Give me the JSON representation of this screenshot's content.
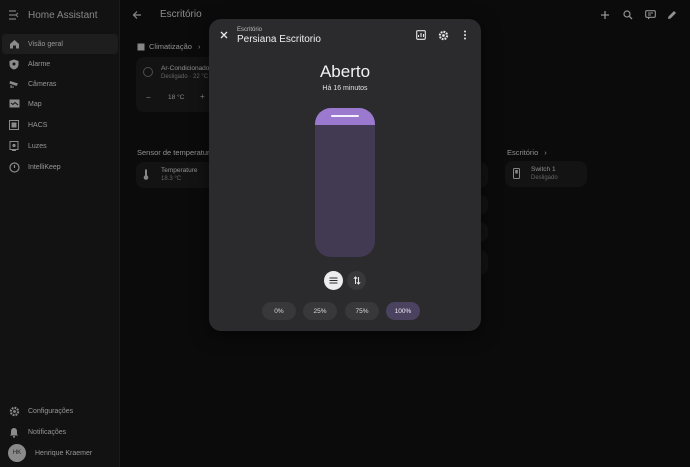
{
  "sidebar": {
    "title": "Home Assistant",
    "items": [
      {
        "label": "Visão geral",
        "icon": "home-icon"
      },
      {
        "label": "Alarme",
        "icon": "shield-icon"
      },
      {
        "label": "Câmeras",
        "icon": "cctv-icon"
      },
      {
        "label": "Map",
        "icon": "map-icon"
      },
      {
        "label": "HACS",
        "icon": "hacs-icon"
      },
      {
        "label": "Luzes",
        "icon": "lightbulb-icon"
      },
      {
        "label": "IntelliKeep",
        "icon": "intellikeep-icon"
      }
    ],
    "bottom": [
      {
        "label": "Configurações",
        "icon": "gear-icon"
      },
      {
        "label": "Notificações",
        "icon": "bell-icon"
      }
    ],
    "user": {
      "initials": "HK",
      "name": "Henrique Kraemer"
    }
  },
  "topbar": {
    "title": "Escritório"
  },
  "background": {
    "climate_section": "Climatização",
    "ac_name": "Ar-Condicionado",
    "ac_state": "Desligado · 22 °C",
    "ac_temp": "18 °C",
    "ac_minus": "−",
    "ac_plus": "+",
    "sensor_section": "Sensor de temperatura",
    "temp_name": "Temperature",
    "temp_value": "18.3 °C",
    "office_section": "Escritório",
    "switch_name": "Switch 1",
    "switch_state": "Desligado"
  },
  "dialog": {
    "subtitle": "Escritório",
    "title": "Persiana Escritorio",
    "state": "Aberto",
    "since": "Há 16 minutos",
    "position_percent": 100,
    "presets": [
      "0%",
      "25%",
      "75%",
      "100%"
    ],
    "selected_preset": "100%",
    "accent": "#9b79cf"
  }
}
